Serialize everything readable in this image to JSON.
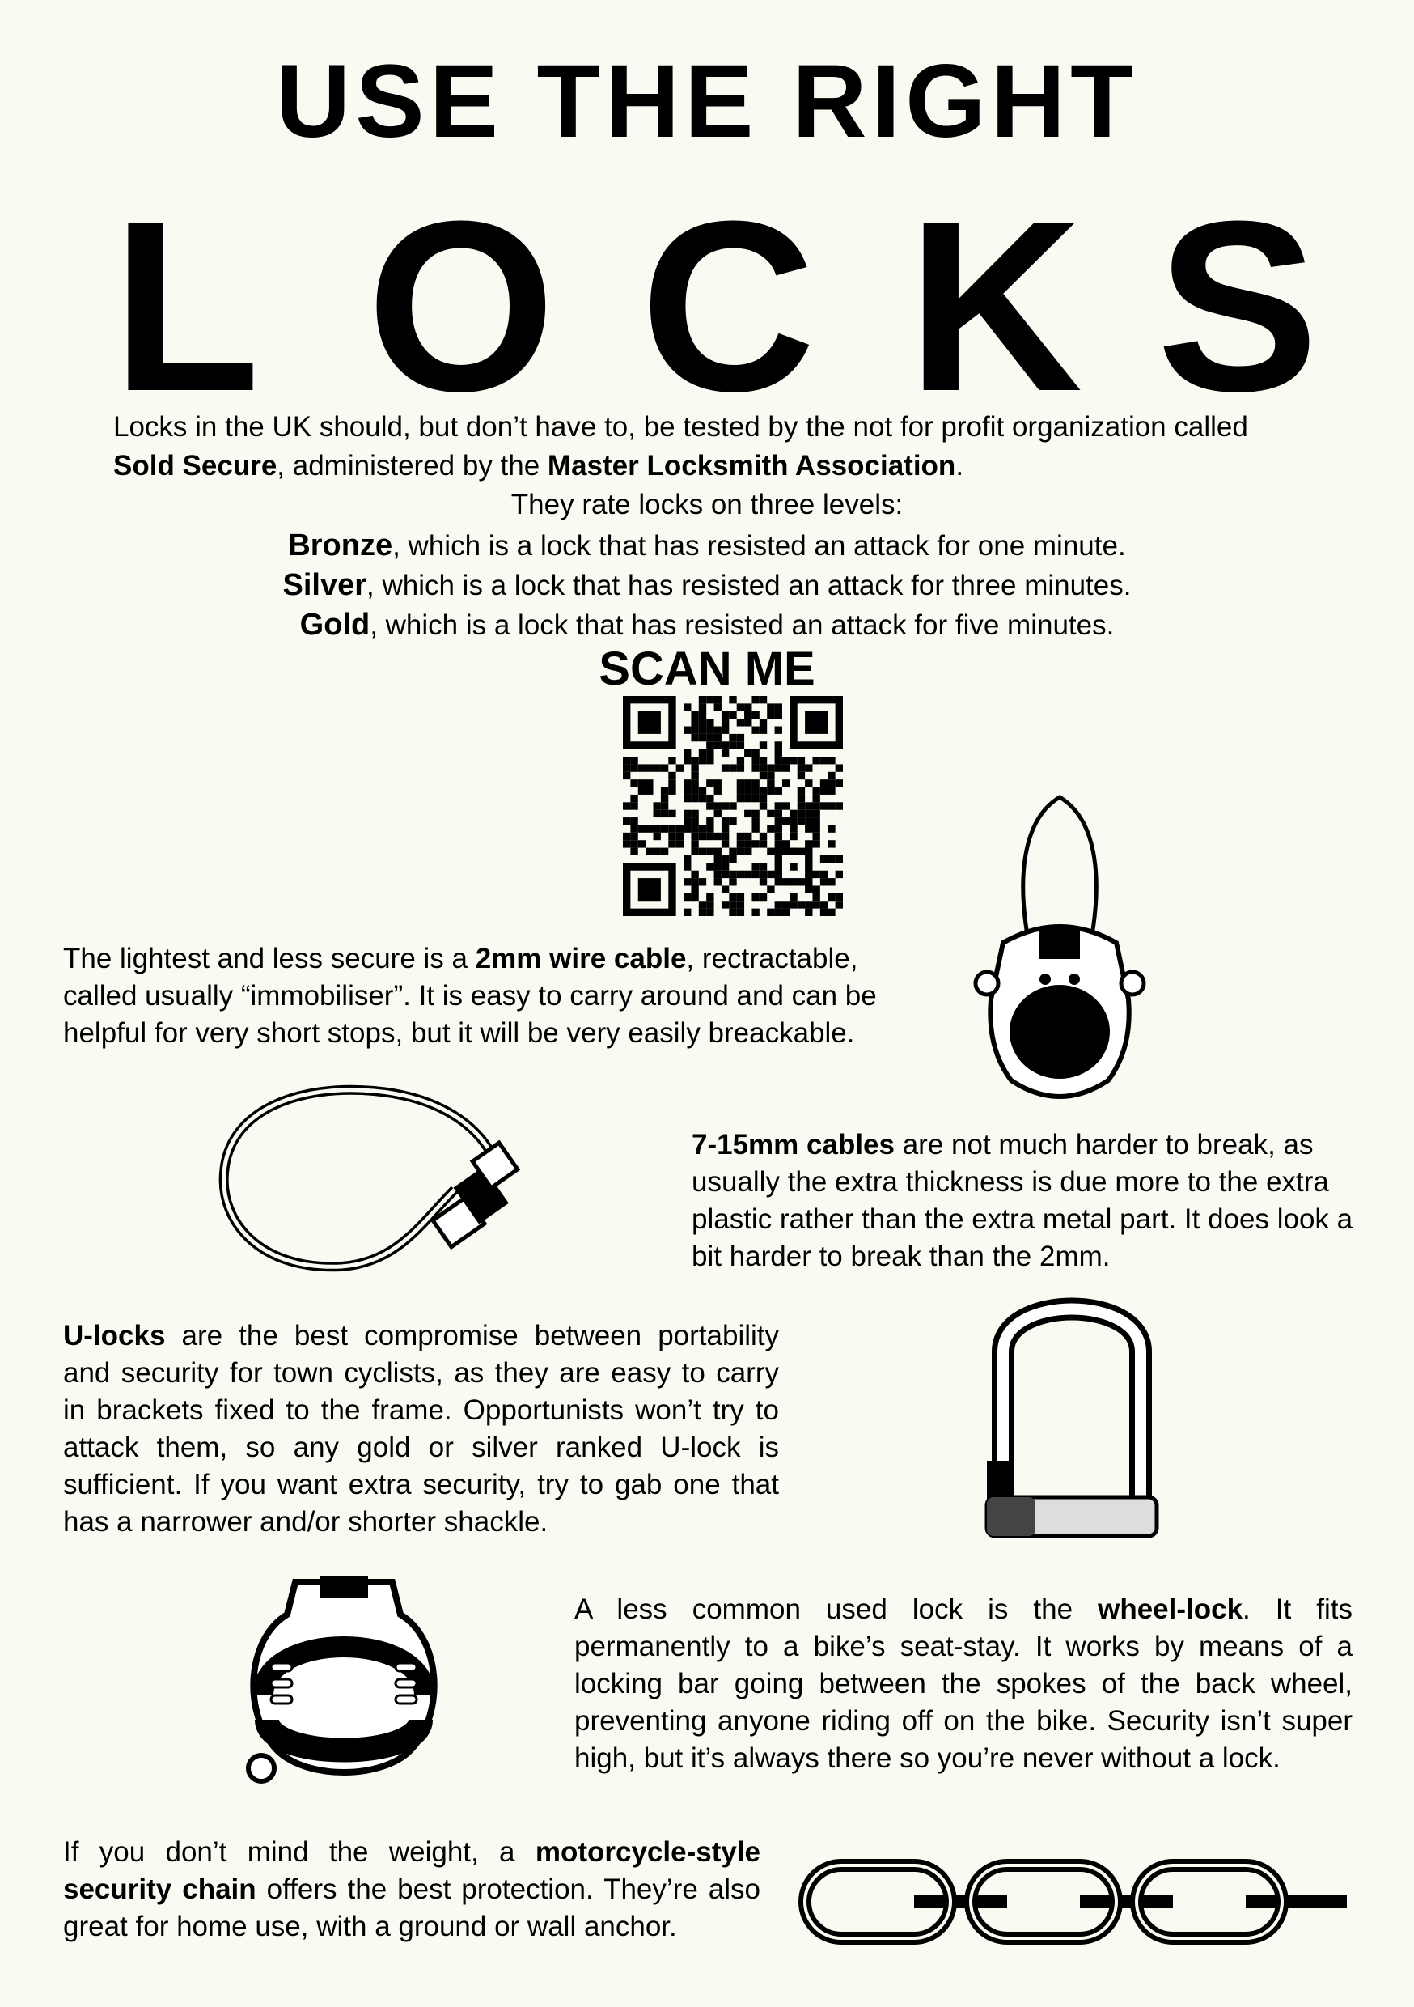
{
  "header": {
    "line1": "USE THE RIGHT",
    "letters": [
      "L",
      "O",
      "C",
      "K",
      "S"
    ]
  },
  "intro": {
    "line1": "Locks in the UK should, but don’t have to, be tested by the not for profit organization called",
    "org_name": "Sold Secure",
    "administered_by": ", administered by the ",
    "association": "Master Locksmith Association",
    "period": ".",
    "rating_intro": "They rate locks on three levels:",
    "levels": [
      {
        "name": "Bronze",
        "desc": ", which is a lock that has resisted an attack for one minute."
      },
      {
        "name": "Silver",
        "desc": ", which is a lock that has resisted an attack for three minutes."
      },
      {
        "name": "Gold",
        "desc": ", which is a lock that has resisted an attack for five minutes."
      }
    ]
  },
  "qr": {
    "label": "SCAN ME"
  },
  "sections": {
    "wire": {
      "pre": "The lightest and less secure is a ",
      "bold": "2mm wire cable",
      "post": ", rectractable, called usually “immobiliser”. It is easy to carry around and can be helpful for very short stops, but it will be very easily breackable."
    },
    "cable": {
      "bold": "7-15mm cables",
      "post": " are not much harder to break, as usually the extra thickness is due more to the extra plastic rather than the extra metal part. It does look a bit harder to break than the 2mm."
    },
    "ulock": {
      "bold": "U-locks",
      "post": " are the best compromise between portability and security for town cyclists, as they are easy to carry in brackets fixed to the frame. Opportunists won’t try to attack them, so any gold or silver ranked U-lock is sufficient. If you want extra security, try to gab one that has a narrower and/or shorter shackle."
    },
    "wheel": {
      "pre": "A less common used lock is the ",
      "bold": "wheel-lock",
      "post": ". It fits permanently to a bike’s seat-stay. It works by means of a locking bar going between the spokes of the back wheel, preventing anyone riding off on the bike. Security isn’t super high, but it’s always there so you’re never without a lock."
    },
    "chain": {
      "pre": "If you don’t mind the weight, a ",
      "bold": "motorcycle-style security chain",
      "post": " offers the best protection. They’re also great for home use, with a ground or wall anchor."
    }
  },
  "illustrations": {
    "wire_lock": "retractable-wire-lock-icon",
    "cable_lock": "cable-lock-icon",
    "u_lock": "u-lock-icon",
    "wheel_lock": "wheel-lock-icon",
    "chain": "security-chain-icon"
  }
}
